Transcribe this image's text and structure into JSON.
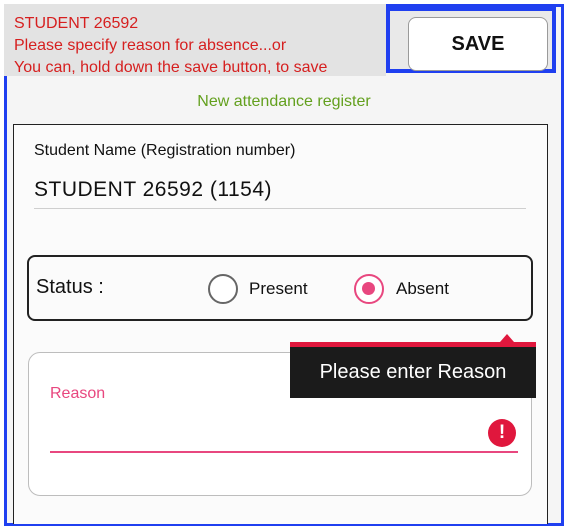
{
  "header": {
    "line1": "STUDENT  26592",
    "line2": "Please specify reason for absence...or",
    "line3": "You can, hold down the save button, to save"
  },
  "toolbar": {
    "save_label": "SAVE"
  },
  "subtitle": "New attendance register",
  "student": {
    "name_label": "Student Name (Registration number)",
    "name_value": "STUDENT  26592  (1154)"
  },
  "status": {
    "label": "Status  :",
    "options": [
      {
        "label": "Present",
        "selected": false
      },
      {
        "label": "Absent",
        "selected": true
      }
    ]
  },
  "reason": {
    "label": "Reason",
    "value": "",
    "error_tooltip": "Please enter Reason"
  },
  "colors": {
    "accent": "#e8477f",
    "error": "#e0173d",
    "highlight_border": "#1f3ff0",
    "header_text": "#d61f1f",
    "subtitle_text": "#63a01e"
  }
}
